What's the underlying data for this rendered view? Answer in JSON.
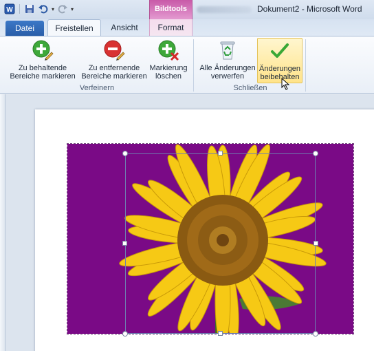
{
  "window": {
    "title": "Dokument2 - Microsoft Word",
    "context_tab_group": "Bildtools"
  },
  "tabs": {
    "datei": "Datei",
    "freistellen": "Freistellen",
    "ansicht": "Ansicht",
    "format": "Format",
    "active": "Freistellen"
  },
  "groups": {
    "verfeinern": {
      "label": "Verfeinern",
      "buttons": [
        {
          "line1": "Zu behaltende",
          "line2": "Bereiche markieren",
          "icon": "plus-pencil-icon"
        },
        {
          "line1": "Zu entfernende",
          "line2": "Bereiche markieren",
          "icon": "minus-pencil-icon"
        },
        {
          "line1": "Markierung",
          "line2": "löschen",
          "icon": "delete-mark-icon"
        }
      ]
    },
    "schliessen": {
      "label": "Schließen",
      "buttons": [
        {
          "line1": "Alle Änderungen",
          "line2": "verwerfen",
          "icon": "recycle-bin-icon"
        },
        {
          "line1": "Änderungen",
          "line2": "beibehalten",
          "icon": "checkmark-icon"
        }
      ]
    }
  },
  "colors": {
    "photo_background": "#7a0a86",
    "accent_context": "#c85aa8",
    "file_tab": "#2a5ea8"
  },
  "quick_access": {
    "icons": [
      "word-logo-icon",
      "save-icon",
      "undo-icon",
      "redo-icon",
      "customize-icon"
    ]
  }
}
